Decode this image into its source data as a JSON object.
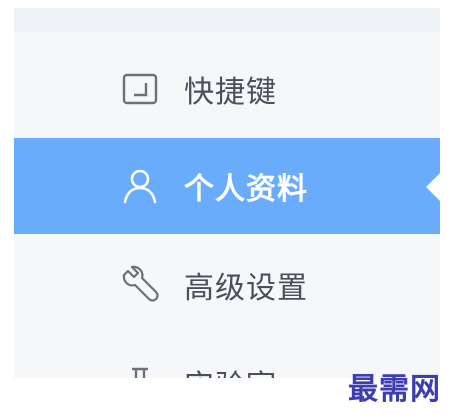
{
  "menu": {
    "items": [
      {
        "label": "快捷键",
        "icon": "keyboard-shortcut-icon",
        "active": false
      },
      {
        "label": "个人资料",
        "icon": "user-icon",
        "active": true
      },
      {
        "label": "高级设置",
        "icon": "wrench-icon",
        "active": false
      },
      {
        "label": "实验室",
        "icon": "flask-icon",
        "active": false
      }
    ]
  },
  "watermark": "最需网",
  "colors": {
    "active_bg": "#69acfb",
    "panel_bg": "#f6f7f9",
    "text": "#4a4f59",
    "watermark": "#3b3db0"
  }
}
